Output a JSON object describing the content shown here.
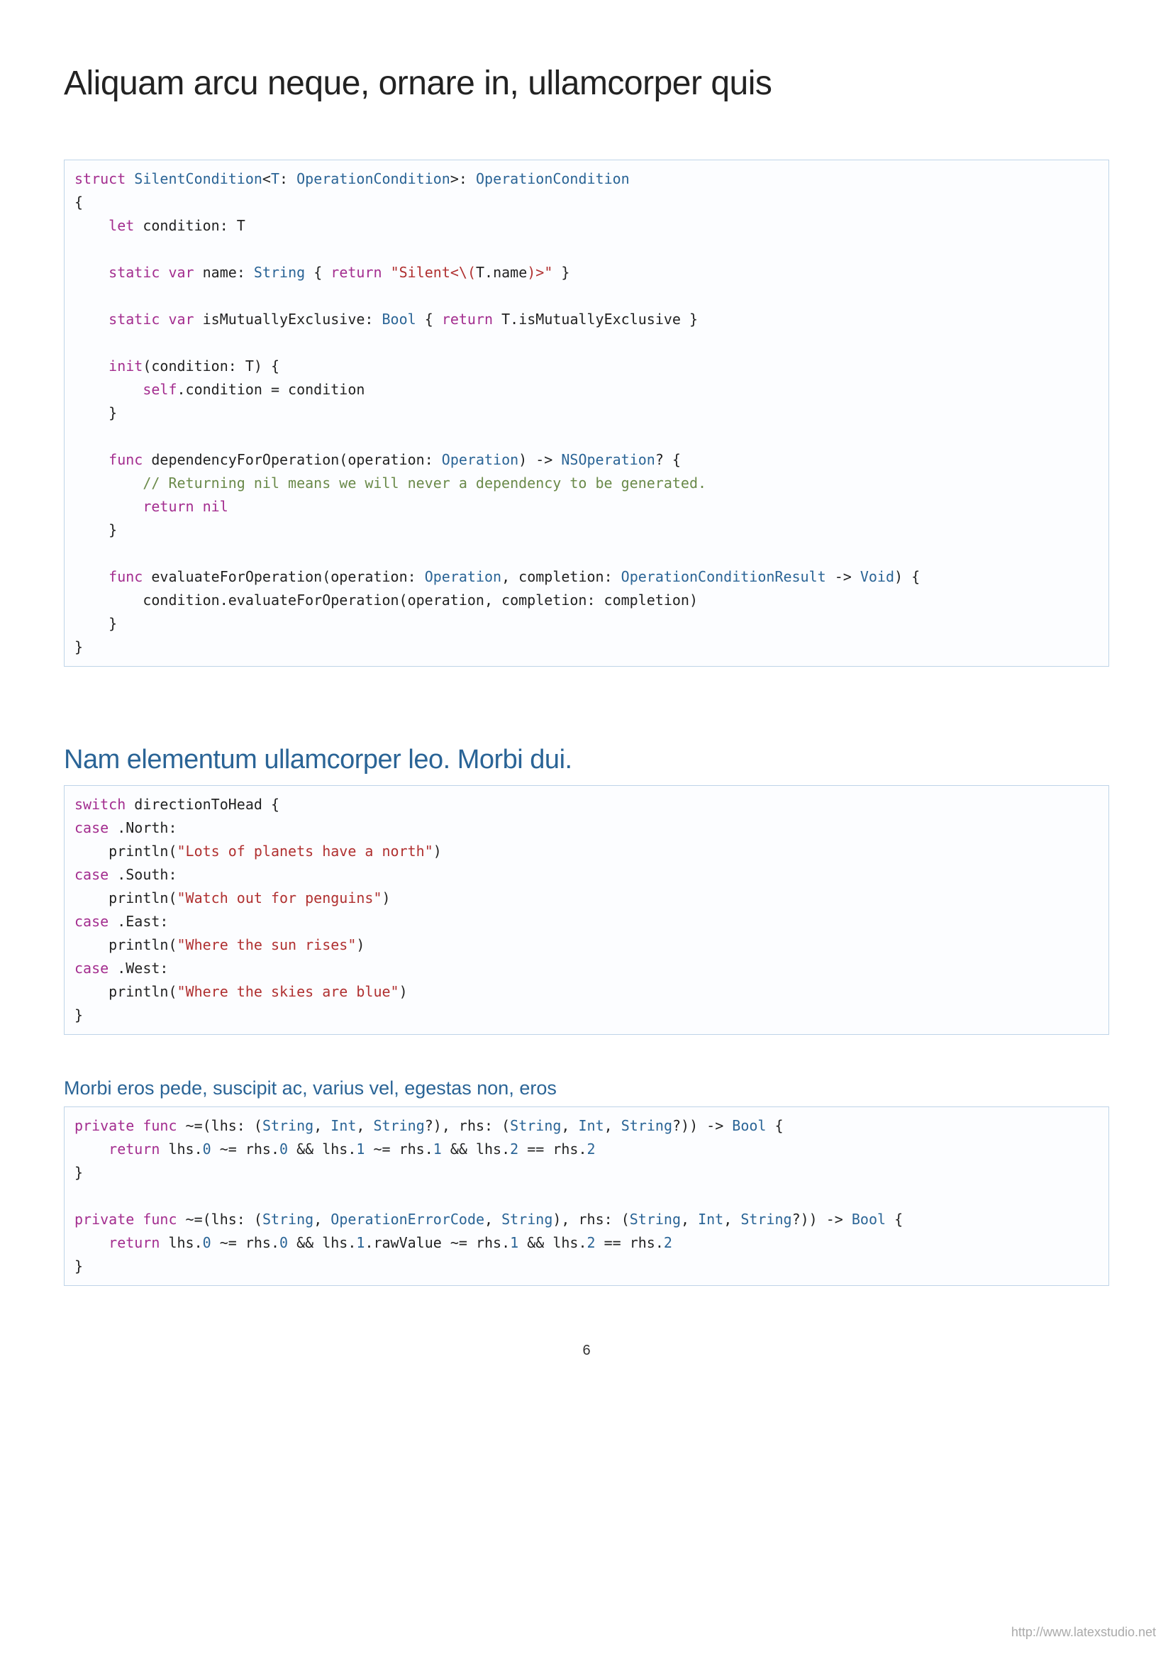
{
  "title": "Aliquam arcu neque, ornare in, ullamcorper quis",
  "section1": {
    "heading": "Nam elementum ullamcorper leo.  Morbi dui."
  },
  "section2": {
    "heading": "Morbi eros pede, suscipit ac, varius vel, egestas non, eros"
  },
  "codeblocks": {
    "block1": {
      "lang": "swift"
    },
    "block2": {
      "lang": "swift"
    },
    "block3": {
      "lang": "swift"
    }
  },
  "code1": {
    "kw_struct": "struct",
    "t_silent": "SilentCondition",
    "t_t": "T",
    "t_opcond": "OperationCondition",
    "kw_let": "let",
    "attr_condition": "condition",
    "kw_static1": "static",
    "kw_var1": "var",
    "attr_name": "name",
    "t_string": "String",
    "kw_return1": "return",
    "str_silent1": "\"Silent<\\(",
    "str_silent2": ")>\"",
    "attr_tname": "T.name",
    "kw_static2": "static",
    "kw_var2": "var",
    "attr_ismutex": "isMutuallyExclusive",
    "t_bool": "Bool",
    "kw_return2": "return",
    "attr_tmutex": "T.isMutuallyExclusive",
    "kw_init": "init",
    "kw_self": "self",
    "kw_func1": "func",
    "fn_dep": "dependencyForOperation",
    "t_nsop": "NSOperation",
    "comment1": "// Returning nil means we will never a dependency to be generated.",
    "kw_return3": "return",
    "kw_nil": "nil",
    "kw_func2": "func",
    "fn_eval": "evaluateForOperation",
    "t_void": "Void",
    "t_opresult": "OperationConditionResult",
    "t_operation": "Operation"
  },
  "code2": {
    "kw_switch": "switch",
    "attr_dir": "directionToHead",
    "kw_case1": "case",
    "case_north": ".North:",
    "fn_println": "println",
    "str_north": "\"Lots of planets have a north\"",
    "kw_case2": "case",
    "case_south": ".South:",
    "str_south": "\"Watch out for penguins\"",
    "kw_case3": "case",
    "case_east": ".East:",
    "str_east": "\"Where the sun rises\"",
    "kw_case4": "case",
    "case_west": ".West:",
    "str_west": "\"Where the skies are blue\""
  },
  "code3": {
    "kw_private": "private",
    "kw_func": "func",
    "t_string": "String",
    "t_int": "Int",
    "t_bool": "Bool",
    "kw_return": "return",
    "num0": "0",
    "num1": "1",
    "num2": "2",
    "t_operr": "OperationErrorCode"
  },
  "pageNumber": "6",
  "footerUrl": "http://www.latexstudio.net"
}
